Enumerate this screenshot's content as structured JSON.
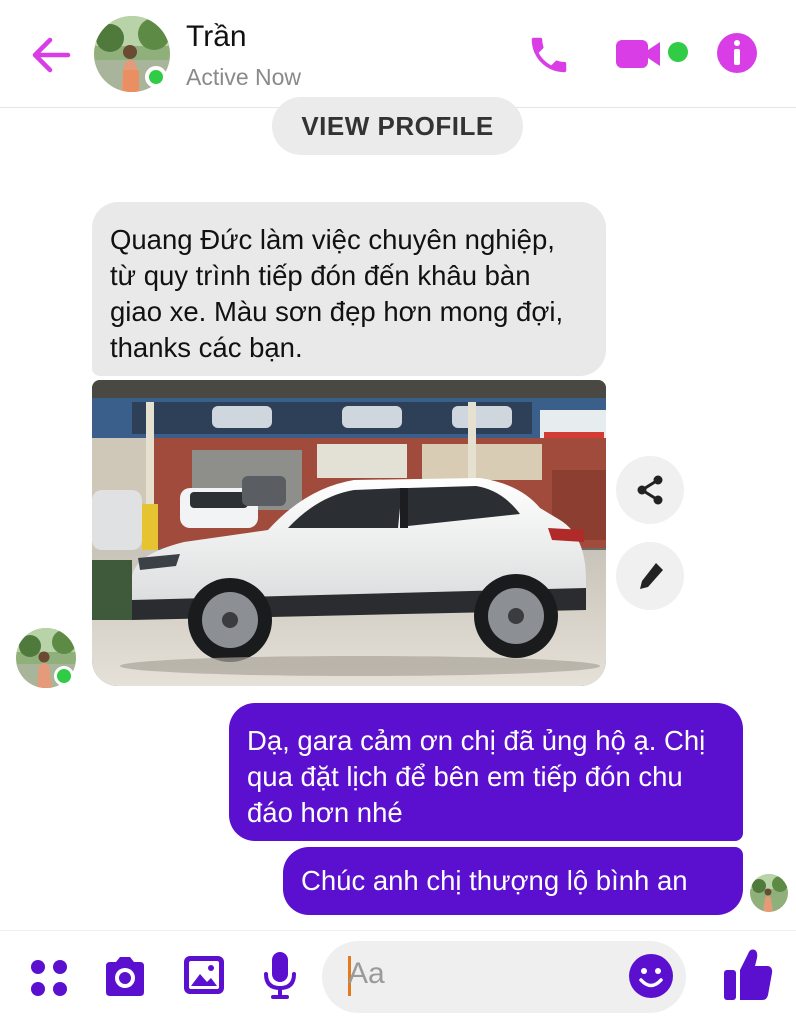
{
  "header": {
    "contact_name": "Trần",
    "status": "Active Now"
  },
  "view_profile_label": "VIEW PROFILE",
  "messages": {
    "received_text": "Quang Đức làm việc chuyên nghiệp, từ quy trình tiếp đón đến khâu bàn giao xe. Màu sơn đẹp hơn mong đợi, thanks các bạn.",
    "sent": [
      "Dạ, gara cảm ơn chị đã ủng hộ ạ. Chị qua đặt lịch để bên em tiếp đón chu đáo hơn nhé",
      "Chúc anh chị thượng lộ bình an"
    ]
  },
  "composer": {
    "placeholder": "Aa"
  },
  "icons": {
    "back": "back-arrow-icon",
    "call": "phone-icon",
    "video": "video-camera-icon",
    "info": "info-icon",
    "share": "share-icon",
    "edit": "pencil-icon",
    "apps": "four-dots-icon",
    "camera": "camera-icon",
    "gallery": "image-icon",
    "mic": "microphone-icon",
    "emoji": "smiley-icon",
    "like": "thumbs-up-icon"
  },
  "colors": {
    "accent": "#d93ee6",
    "composer_accent": "#5b0fcf",
    "sent_bubble": "#5b0fcf",
    "received_bubble": "#e9e9ea",
    "online": "#31cc46"
  }
}
